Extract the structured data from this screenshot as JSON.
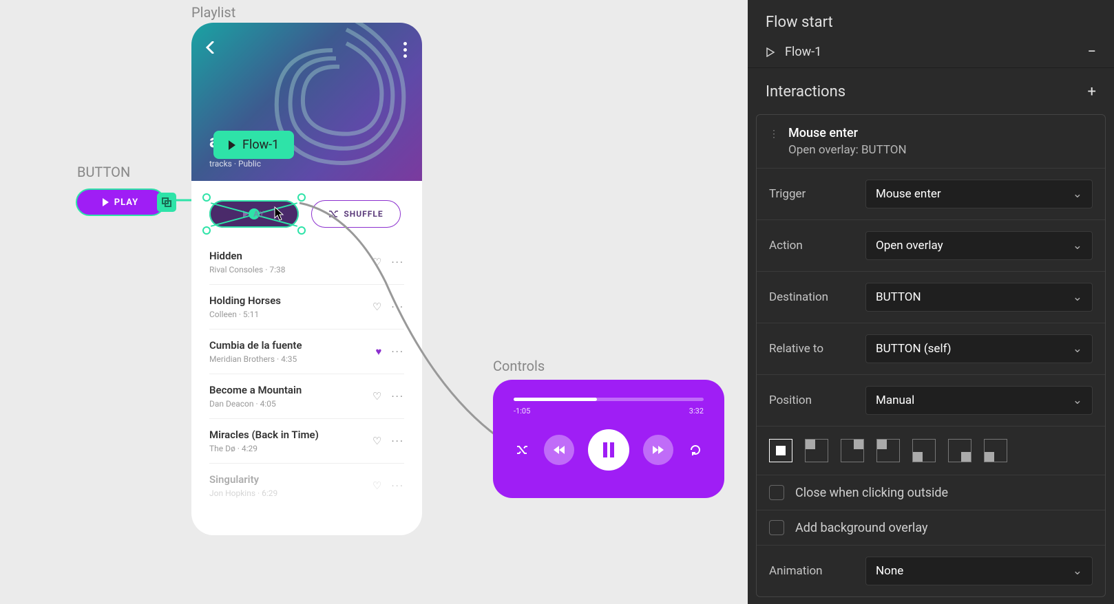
{
  "canvas": {
    "labels": {
      "playlist": "Playlist",
      "button": "BUTTON",
      "controls": "Controls"
    }
  },
  "button_component": {
    "label": "PLAY"
  },
  "flow_badge": "Flow-1",
  "playlist": {
    "title": "ape",
    "subtitle_prefix": "tracks",
    "subtitle_visibility": "Public",
    "shuffle": "SHUFFLE",
    "play_target": "AY",
    "tracks": [
      {
        "title": "Hidden",
        "artist": "Rival Consoles",
        "duration": "7:38",
        "liked": false
      },
      {
        "title": "Holding Horses",
        "artist": "Colleen",
        "duration": "5:11",
        "liked": false
      },
      {
        "title": "Cumbia de la fuente",
        "artist": "Meridian Brothers",
        "duration": "4:35",
        "liked": true
      },
      {
        "title": "Become a Mountain",
        "artist": "Dan Deacon",
        "duration": "4:05",
        "liked": false
      },
      {
        "title": "Miracles (Back in Time)",
        "artist": "The Dø",
        "duration": "4:29",
        "liked": false
      },
      {
        "title": "Singularity",
        "artist": "Jon Hopkins",
        "duration": "6:29",
        "liked": false
      }
    ]
  },
  "controls": {
    "elapsed": "-1:05",
    "remaining": "3:32"
  },
  "panel": {
    "flow_start_title": "Flow start",
    "flow_name": "Flow-1",
    "interactions_title": "Interactions",
    "card": {
      "event": "Mouse enter",
      "summary": "Open overlay: BUTTON"
    },
    "props": {
      "trigger_label": "Trigger",
      "trigger_value": "Mouse enter",
      "action_label": "Action",
      "action_value": "Open overlay",
      "destination_label": "Destination",
      "destination_value": "BUTTON",
      "relative_label": "Relative to",
      "relative_value": "BUTTON (self)",
      "position_label": "Position",
      "position_value": "Manual",
      "animation_label": "Animation",
      "animation_value": "None"
    },
    "checkboxes": {
      "close_outside": "Close when clicking outside",
      "bg_overlay": "Add background overlay"
    }
  }
}
